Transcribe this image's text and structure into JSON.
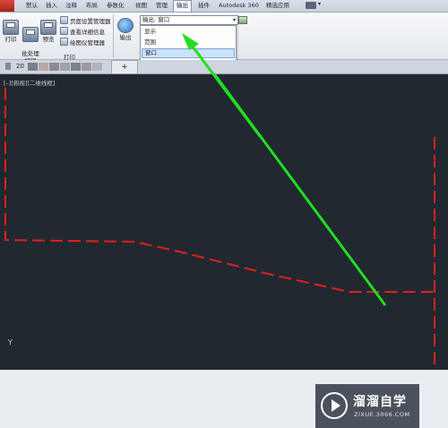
{
  "ribbon_tabs": [
    "默认",
    "插入",
    "注释",
    "布局",
    "参数化",
    "视图",
    "管理",
    "输出",
    "插件",
    "Autodesk 360",
    "精选应用"
  ],
  "active_tab": "输出",
  "print_panel": {
    "print_label": "打印",
    "batch_plot_label": "批处理\n打印",
    "preview_label": "预览",
    "page_setup_manager": "页面设置管理器",
    "view_details": "查看详细信息",
    "plotter_manager": "绘图仪管理器",
    "panel_title": "打印"
  },
  "output_button_label": "输出",
  "export_dropdown": {
    "value": "输出: 窗口",
    "options": [
      "显示",
      "范围",
      "窗口"
    ],
    "selected": "窗口"
  },
  "file_tab_number": "20",
  "viewport_label": "[–][俯视][二维线框]",
  "y_axis_label": "Y",
  "watermark": {
    "title": "溜溜自学",
    "url": "ZIXUE.3066.COM"
  },
  "colors": {
    "canvas_bg": "#212830",
    "dashed_line": "#e0211f",
    "arrow": "#22dd22"
  }
}
